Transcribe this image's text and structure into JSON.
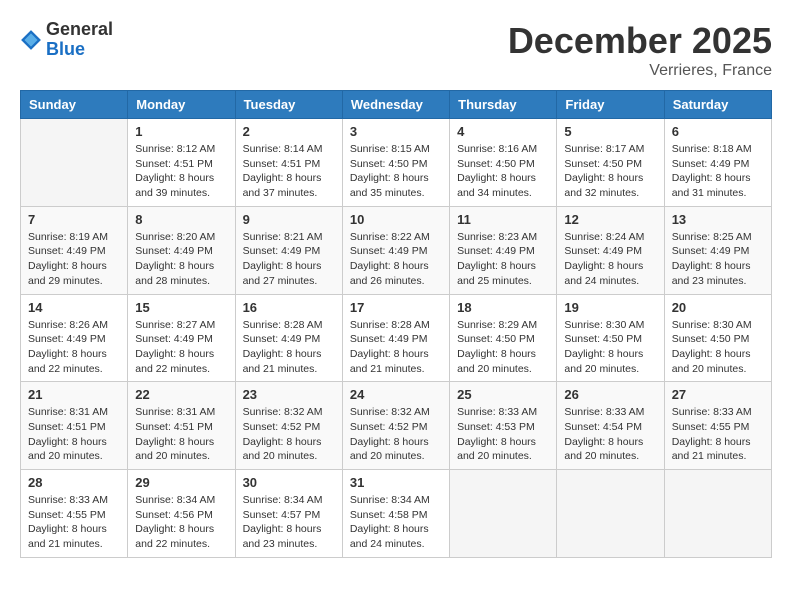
{
  "header": {
    "logo_general": "General",
    "logo_blue": "Blue",
    "month_title": "December 2025",
    "location": "Verrieres, France"
  },
  "calendar": {
    "days_of_week": [
      "Sunday",
      "Monday",
      "Tuesday",
      "Wednesday",
      "Thursday",
      "Friday",
      "Saturday"
    ],
    "weeks": [
      [
        {
          "day": "",
          "sunrise": "",
          "sunset": "",
          "daylight": "",
          "empty": true
        },
        {
          "day": "1",
          "sunrise": "Sunrise: 8:12 AM",
          "sunset": "Sunset: 4:51 PM",
          "daylight": "Daylight: 8 hours and 39 minutes."
        },
        {
          "day": "2",
          "sunrise": "Sunrise: 8:14 AM",
          "sunset": "Sunset: 4:51 PM",
          "daylight": "Daylight: 8 hours and 37 minutes."
        },
        {
          "day": "3",
          "sunrise": "Sunrise: 8:15 AM",
          "sunset": "Sunset: 4:50 PM",
          "daylight": "Daylight: 8 hours and 35 minutes."
        },
        {
          "day": "4",
          "sunrise": "Sunrise: 8:16 AM",
          "sunset": "Sunset: 4:50 PM",
          "daylight": "Daylight: 8 hours and 34 minutes."
        },
        {
          "day": "5",
          "sunrise": "Sunrise: 8:17 AM",
          "sunset": "Sunset: 4:50 PM",
          "daylight": "Daylight: 8 hours and 32 minutes."
        },
        {
          "day": "6",
          "sunrise": "Sunrise: 8:18 AM",
          "sunset": "Sunset: 4:49 PM",
          "daylight": "Daylight: 8 hours and 31 minutes."
        }
      ],
      [
        {
          "day": "7",
          "sunrise": "Sunrise: 8:19 AM",
          "sunset": "Sunset: 4:49 PM",
          "daylight": "Daylight: 8 hours and 29 minutes."
        },
        {
          "day": "8",
          "sunrise": "Sunrise: 8:20 AM",
          "sunset": "Sunset: 4:49 PM",
          "daylight": "Daylight: 8 hours and 28 minutes."
        },
        {
          "day": "9",
          "sunrise": "Sunrise: 8:21 AM",
          "sunset": "Sunset: 4:49 PM",
          "daylight": "Daylight: 8 hours and 27 minutes."
        },
        {
          "day": "10",
          "sunrise": "Sunrise: 8:22 AM",
          "sunset": "Sunset: 4:49 PM",
          "daylight": "Daylight: 8 hours and 26 minutes."
        },
        {
          "day": "11",
          "sunrise": "Sunrise: 8:23 AM",
          "sunset": "Sunset: 4:49 PM",
          "daylight": "Daylight: 8 hours and 25 minutes."
        },
        {
          "day": "12",
          "sunrise": "Sunrise: 8:24 AM",
          "sunset": "Sunset: 4:49 PM",
          "daylight": "Daylight: 8 hours and 24 minutes."
        },
        {
          "day": "13",
          "sunrise": "Sunrise: 8:25 AM",
          "sunset": "Sunset: 4:49 PM",
          "daylight": "Daylight: 8 hours and 23 minutes."
        }
      ],
      [
        {
          "day": "14",
          "sunrise": "Sunrise: 8:26 AM",
          "sunset": "Sunset: 4:49 PM",
          "daylight": "Daylight: 8 hours and 22 minutes."
        },
        {
          "day": "15",
          "sunrise": "Sunrise: 8:27 AM",
          "sunset": "Sunset: 4:49 PM",
          "daylight": "Daylight: 8 hours and 22 minutes."
        },
        {
          "day": "16",
          "sunrise": "Sunrise: 8:28 AM",
          "sunset": "Sunset: 4:49 PM",
          "daylight": "Daylight: 8 hours and 21 minutes."
        },
        {
          "day": "17",
          "sunrise": "Sunrise: 8:28 AM",
          "sunset": "Sunset: 4:49 PM",
          "daylight": "Daylight: 8 hours and 21 minutes."
        },
        {
          "day": "18",
          "sunrise": "Sunrise: 8:29 AM",
          "sunset": "Sunset: 4:50 PM",
          "daylight": "Daylight: 8 hours and 20 minutes."
        },
        {
          "day": "19",
          "sunrise": "Sunrise: 8:30 AM",
          "sunset": "Sunset: 4:50 PM",
          "daylight": "Daylight: 8 hours and 20 minutes."
        },
        {
          "day": "20",
          "sunrise": "Sunrise: 8:30 AM",
          "sunset": "Sunset: 4:50 PM",
          "daylight": "Daylight: 8 hours and 20 minutes."
        }
      ],
      [
        {
          "day": "21",
          "sunrise": "Sunrise: 8:31 AM",
          "sunset": "Sunset: 4:51 PM",
          "daylight": "Daylight: 8 hours and 20 minutes."
        },
        {
          "day": "22",
          "sunrise": "Sunrise: 8:31 AM",
          "sunset": "Sunset: 4:51 PM",
          "daylight": "Daylight: 8 hours and 20 minutes."
        },
        {
          "day": "23",
          "sunrise": "Sunrise: 8:32 AM",
          "sunset": "Sunset: 4:52 PM",
          "daylight": "Daylight: 8 hours and 20 minutes."
        },
        {
          "day": "24",
          "sunrise": "Sunrise: 8:32 AM",
          "sunset": "Sunset: 4:52 PM",
          "daylight": "Daylight: 8 hours and 20 minutes."
        },
        {
          "day": "25",
          "sunrise": "Sunrise: 8:33 AM",
          "sunset": "Sunset: 4:53 PM",
          "daylight": "Daylight: 8 hours and 20 minutes."
        },
        {
          "day": "26",
          "sunrise": "Sunrise: 8:33 AM",
          "sunset": "Sunset: 4:54 PM",
          "daylight": "Daylight: 8 hours and 20 minutes."
        },
        {
          "day": "27",
          "sunrise": "Sunrise: 8:33 AM",
          "sunset": "Sunset: 4:55 PM",
          "daylight": "Daylight: 8 hours and 21 minutes."
        }
      ],
      [
        {
          "day": "28",
          "sunrise": "Sunrise: 8:33 AM",
          "sunset": "Sunset: 4:55 PM",
          "daylight": "Daylight: 8 hours and 21 minutes."
        },
        {
          "day": "29",
          "sunrise": "Sunrise: 8:34 AM",
          "sunset": "Sunset: 4:56 PM",
          "daylight": "Daylight: 8 hours and 22 minutes."
        },
        {
          "day": "30",
          "sunrise": "Sunrise: 8:34 AM",
          "sunset": "Sunset: 4:57 PM",
          "daylight": "Daylight: 8 hours and 23 minutes."
        },
        {
          "day": "31",
          "sunrise": "Sunrise: 8:34 AM",
          "sunset": "Sunset: 4:58 PM",
          "daylight": "Daylight: 8 hours and 24 minutes."
        },
        {
          "day": "",
          "sunrise": "",
          "sunset": "",
          "daylight": "",
          "empty": true
        },
        {
          "day": "",
          "sunrise": "",
          "sunset": "",
          "daylight": "",
          "empty": true
        },
        {
          "day": "",
          "sunrise": "",
          "sunset": "",
          "daylight": "",
          "empty": true
        }
      ]
    ]
  }
}
